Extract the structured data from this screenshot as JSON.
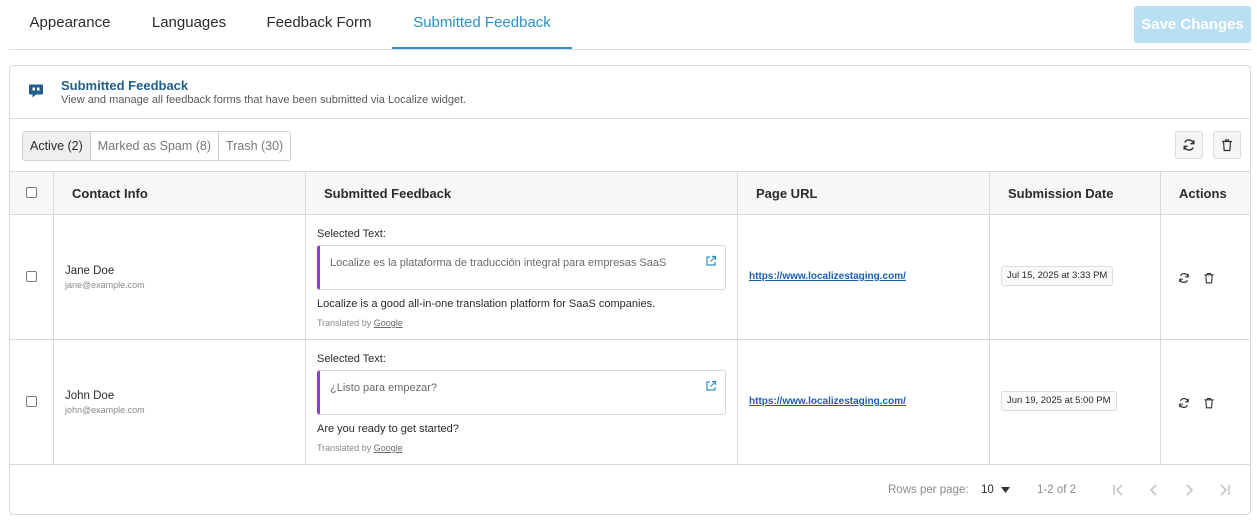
{
  "tabs": [
    {
      "label": "Appearance"
    },
    {
      "label": "Languages"
    },
    {
      "label": "Feedback Form"
    },
    {
      "label": "Submitted Feedback"
    }
  ],
  "save_button": "Save Changes",
  "panel": {
    "title": "Submitted Feedback",
    "subtitle": "View and manage all feedback forms that have been submitted via Localize widget."
  },
  "filters": [
    {
      "label": "Active (2)"
    },
    {
      "label": "Marked as Spam (8)"
    },
    {
      "label": "Trash (30)"
    }
  ],
  "columns": {
    "contact": "Contact Info",
    "feedback": "Submitted Feedback",
    "url": "Page URL",
    "date": "Submission Date",
    "actions": "Actions"
  },
  "rows": [
    {
      "name": "Jane Doe",
      "email": "jane@example.com",
      "selected_label": "Selected Text:",
      "selected_text": "Localize es la plataforma de traducción integral para empresas SaaS",
      "translation": "Localize is a good all-in-one translation platform for SaaS companies.",
      "translated_by": "Translated by",
      "translator": "Google",
      "url": "https://www.localizestaging.com/",
      "date": "Jul 15, 2025 at 3:33 PM"
    },
    {
      "name": "John Doe",
      "email": "john@example.com",
      "selected_label": "Selected Text:",
      "selected_text": "¿Listo para empezar?",
      "translation": "Are you ready to get started?",
      "translated_by": "Translated by",
      "translator": "Google",
      "url": "https://www.localizestaging.com/",
      "date": "Jun 19, 2025 at 5:00 PM"
    }
  ],
  "pagination": {
    "rows_per_page_label": "Rows per page:",
    "rows_per_page": "10",
    "range": "1-2 of 2"
  },
  "colors": {
    "accent": "#2d8fc4",
    "save_button_bg": "#b9dff2",
    "quote_border": "#8a3fd1",
    "link": "#1a5fb4"
  },
  "icons": [
    "feedback-icon",
    "refresh-icon",
    "trash-icon",
    "external-link-icon",
    "first-page-icon",
    "prev-page-icon",
    "next-page-icon",
    "last-page-icon",
    "caret-down-icon"
  ]
}
